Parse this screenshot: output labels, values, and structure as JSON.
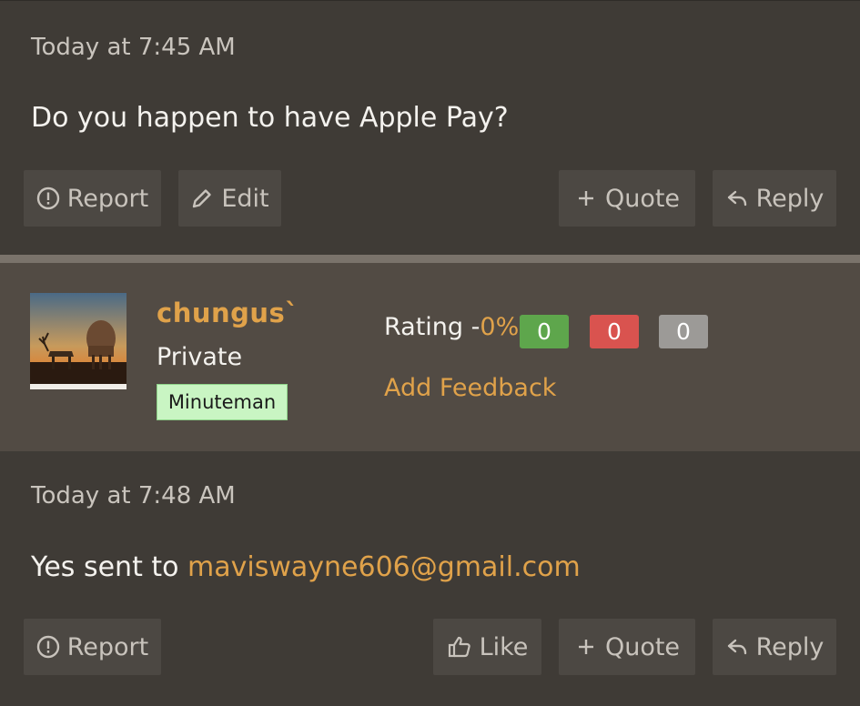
{
  "post1": {
    "timestamp": "Today at 7:45 AM",
    "message": "Do you happen to have Apple Pay?",
    "actions": {
      "report": "Report",
      "edit": "Edit",
      "quote": "Quote",
      "reply": "Reply"
    }
  },
  "user": {
    "name": "chungus`",
    "rank": "Private",
    "badge": "Minuteman",
    "rating_label": "Rating -",
    "rating_pct": "0%",
    "scores": {
      "positive": "0",
      "negative": "0",
      "neutral": "0"
    },
    "add_feedback": "Add Feedback"
  },
  "post2": {
    "timestamp": "Today at 7:48 AM",
    "message_prefix": "Yes sent to ",
    "email": "maviswayne606@gmail.com",
    "actions": {
      "report": "Report",
      "like": "Like",
      "quote": "Quote",
      "reply": "Reply"
    }
  },
  "colors": {
    "accent": "#e0a24a",
    "positive": "#5ea64c",
    "negative": "#d9534f",
    "neutral": "#9c9a97",
    "badge_bg": "#c9f5c3"
  }
}
